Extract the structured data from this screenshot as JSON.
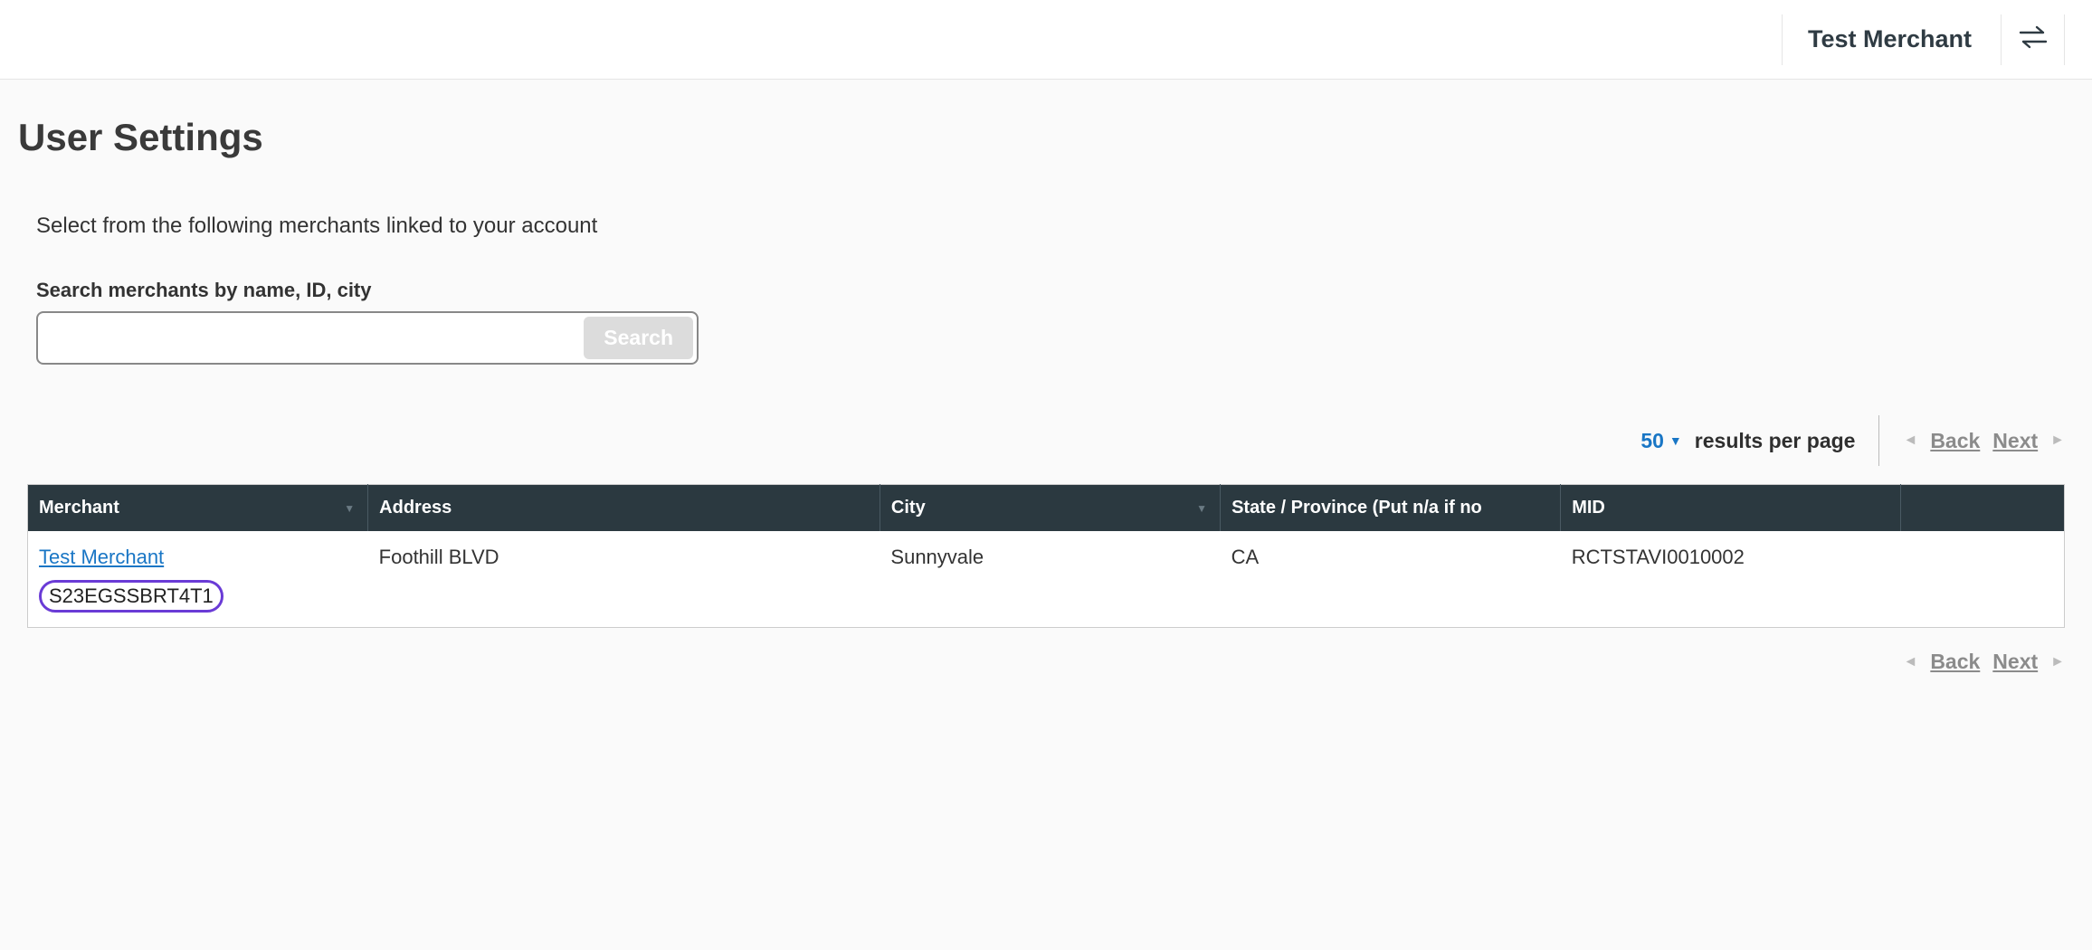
{
  "header": {
    "merchant_name": "Test Merchant"
  },
  "page": {
    "title": "User Settings",
    "instruction": "Select from the following merchants linked to your account"
  },
  "search": {
    "label": "Search merchants by name, ID, city",
    "value": "",
    "placeholder": "",
    "button_label": "Search"
  },
  "pager": {
    "page_size": "50",
    "results_label": "results per page",
    "back_label": "Back",
    "next_label": "Next"
  },
  "table": {
    "columns": [
      {
        "label": "Merchant",
        "sortable": true
      },
      {
        "label": "Address",
        "sortable": false
      },
      {
        "label": "City",
        "sortable": true
      },
      {
        "label": "State / Province (Put n/a if no",
        "sortable": false
      },
      {
        "label": "MID",
        "sortable": false
      },
      {
        "label": "",
        "sortable": false
      }
    ],
    "rows": [
      {
        "merchant_name": "Test Merchant",
        "merchant_id": "S23EGSSBRT4T1",
        "address": "Foothill BLVD",
        "city": "Sunnyvale",
        "state": "CA",
        "mid": "RCTSTAVI0010002"
      }
    ]
  }
}
